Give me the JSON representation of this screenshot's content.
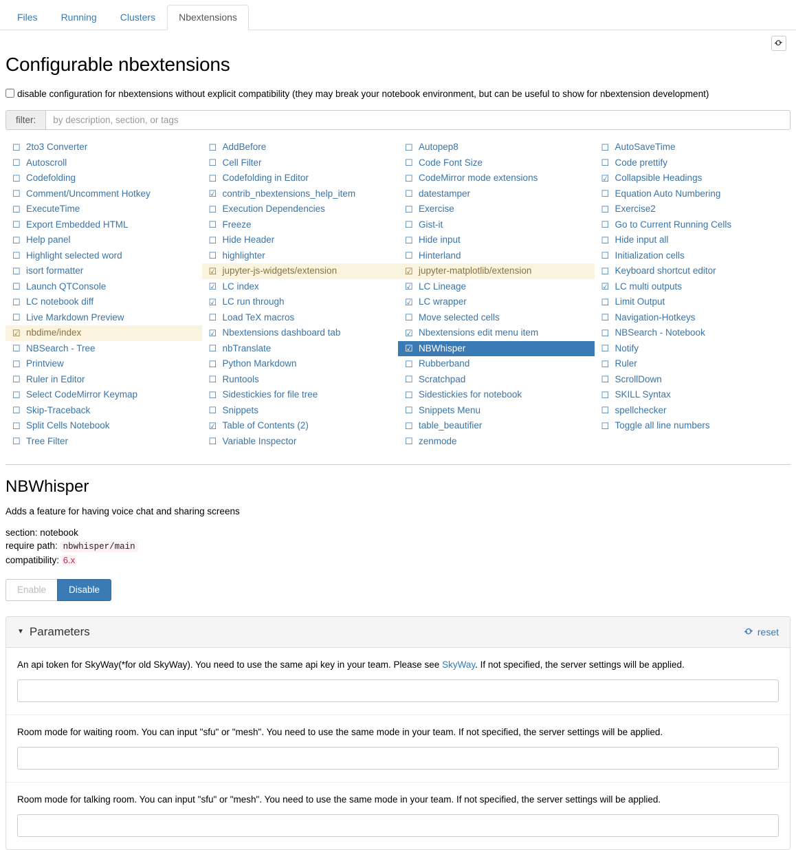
{
  "tabs": [
    {
      "label": "Files",
      "active": false
    },
    {
      "label": "Running",
      "active": false
    },
    {
      "label": "Clusters",
      "active": false
    },
    {
      "label": "Nbextensions",
      "active": true
    }
  ],
  "header": {
    "title": "Configurable nbextensions",
    "refresh_icon": "refresh-icon"
  },
  "disable_config": {
    "checked": false,
    "label": "disable configuration for nbextensions without explicit compatibility (they may break your notebook environment, but can be useful to show for nbextension development)"
  },
  "filter": {
    "label": "filter:",
    "placeholder": "by description, section, or tags",
    "value": ""
  },
  "extensions": [
    {
      "name": "2to3 Converter",
      "checked": false,
      "state": "normal"
    },
    {
      "name": "Autoscroll",
      "checked": false,
      "state": "normal"
    },
    {
      "name": "Codefolding",
      "checked": false,
      "state": "normal"
    },
    {
      "name": "Comment/Uncomment Hotkey",
      "checked": false,
      "state": "normal"
    },
    {
      "name": "ExecuteTime",
      "checked": false,
      "state": "normal"
    },
    {
      "name": "Export Embedded HTML",
      "checked": false,
      "state": "normal"
    },
    {
      "name": "Help panel",
      "checked": false,
      "state": "normal"
    },
    {
      "name": "Highlight selected word",
      "checked": false,
      "state": "normal"
    },
    {
      "name": "isort formatter",
      "checked": false,
      "state": "normal"
    },
    {
      "name": "Launch QTConsole",
      "checked": false,
      "state": "normal"
    },
    {
      "name": "LC notebook diff",
      "checked": false,
      "state": "normal"
    },
    {
      "name": "Live Markdown Preview",
      "checked": false,
      "state": "normal"
    },
    {
      "name": "nbdime/index",
      "checked": true,
      "state": "incompatible"
    },
    {
      "name": "NBSearch - Tree",
      "checked": false,
      "state": "normal"
    },
    {
      "name": "Printview",
      "checked": false,
      "state": "normal"
    },
    {
      "name": "Ruler in Editor",
      "checked": false,
      "state": "normal"
    },
    {
      "name": "Select CodeMirror Keymap",
      "checked": false,
      "state": "normal"
    },
    {
      "name": "Skip-Traceback",
      "checked": false,
      "state": "normal"
    },
    {
      "name": "Split Cells Notebook",
      "checked": false,
      "state": "normal"
    },
    {
      "name": "Tree Filter",
      "checked": false,
      "state": "normal"
    },
    {
      "name": "AddBefore",
      "checked": false,
      "state": "normal"
    },
    {
      "name": "Cell Filter",
      "checked": false,
      "state": "normal"
    },
    {
      "name": "Codefolding in Editor",
      "checked": false,
      "state": "normal"
    },
    {
      "name": "contrib_nbextensions_help_item",
      "checked": true,
      "state": "normal"
    },
    {
      "name": "Execution Dependencies",
      "checked": false,
      "state": "normal"
    },
    {
      "name": "Freeze",
      "checked": false,
      "state": "normal"
    },
    {
      "name": "Hide Header",
      "checked": false,
      "state": "normal"
    },
    {
      "name": "highlighter",
      "checked": false,
      "state": "normal"
    },
    {
      "name": "jupyter-js-widgets/extension",
      "checked": true,
      "state": "incompatible"
    },
    {
      "name": "LC index",
      "checked": true,
      "state": "normal"
    },
    {
      "name": "LC run through",
      "checked": true,
      "state": "normal"
    },
    {
      "name": "Load TeX macros",
      "checked": false,
      "state": "normal"
    },
    {
      "name": "Nbextensions dashboard tab",
      "checked": true,
      "state": "normal"
    },
    {
      "name": "nbTranslate",
      "checked": false,
      "state": "normal"
    },
    {
      "name": "Python Markdown",
      "checked": false,
      "state": "normal"
    },
    {
      "name": "Runtools",
      "checked": false,
      "state": "normal"
    },
    {
      "name": "Sidestickies for file tree",
      "checked": false,
      "state": "normal"
    },
    {
      "name": "Snippets",
      "checked": false,
      "state": "normal"
    },
    {
      "name": "Table of Contents (2)",
      "checked": true,
      "state": "normal"
    },
    {
      "name": "Variable Inspector",
      "checked": false,
      "state": "normal"
    },
    {
      "name": "Autopep8",
      "checked": false,
      "state": "normal"
    },
    {
      "name": "Code Font Size",
      "checked": false,
      "state": "normal"
    },
    {
      "name": "CodeMirror mode extensions",
      "checked": false,
      "state": "normal"
    },
    {
      "name": "datestamper",
      "checked": false,
      "state": "normal"
    },
    {
      "name": "Exercise",
      "checked": false,
      "state": "normal"
    },
    {
      "name": "Gist-it",
      "checked": false,
      "state": "normal"
    },
    {
      "name": "Hide input",
      "checked": false,
      "state": "normal"
    },
    {
      "name": "Hinterland",
      "checked": false,
      "state": "normal"
    },
    {
      "name": "jupyter-matplotlib/extension",
      "checked": true,
      "state": "incompatible"
    },
    {
      "name": "LC Lineage",
      "checked": true,
      "state": "normal"
    },
    {
      "name": "LC wrapper",
      "checked": true,
      "state": "normal"
    },
    {
      "name": "Move selected cells",
      "checked": false,
      "state": "normal"
    },
    {
      "name": "Nbextensions edit menu item",
      "checked": true,
      "state": "normal"
    },
    {
      "name": "NBWhisper",
      "checked": true,
      "state": "selected"
    },
    {
      "name": "Rubberband",
      "checked": false,
      "state": "normal"
    },
    {
      "name": "Scratchpad",
      "checked": false,
      "state": "normal"
    },
    {
      "name": "Sidestickies for notebook",
      "checked": false,
      "state": "normal"
    },
    {
      "name": "Snippets Menu",
      "checked": false,
      "state": "normal"
    },
    {
      "name": "table_beautifier",
      "checked": false,
      "state": "normal"
    },
    {
      "name": "zenmode",
      "checked": false,
      "state": "normal"
    },
    {
      "name": "AutoSaveTime",
      "checked": false,
      "state": "normal"
    },
    {
      "name": "Code prettify",
      "checked": false,
      "state": "normal"
    },
    {
      "name": "Collapsible Headings",
      "checked": true,
      "state": "normal"
    },
    {
      "name": "Equation Auto Numbering",
      "checked": false,
      "state": "normal"
    },
    {
      "name": "Exercise2",
      "checked": false,
      "state": "normal"
    },
    {
      "name": "Go to Current Running Cells",
      "checked": false,
      "state": "normal"
    },
    {
      "name": "Hide input all",
      "checked": false,
      "state": "normal"
    },
    {
      "name": "Initialization cells",
      "checked": false,
      "state": "normal"
    },
    {
      "name": "Keyboard shortcut editor",
      "checked": false,
      "state": "normal"
    },
    {
      "name": "LC multi outputs",
      "checked": true,
      "state": "normal"
    },
    {
      "name": "Limit Output",
      "checked": false,
      "state": "normal"
    },
    {
      "name": "Navigation-Hotkeys",
      "checked": false,
      "state": "normal"
    },
    {
      "name": "NBSearch - Notebook",
      "checked": false,
      "state": "normal"
    },
    {
      "name": "Notify",
      "checked": false,
      "state": "normal"
    },
    {
      "name": "Ruler",
      "checked": false,
      "state": "normal"
    },
    {
      "name": "ScrollDown",
      "checked": false,
      "state": "normal"
    },
    {
      "name": "SKILL Syntax",
      "checked": false,
      "state": "normal"
    },
    {
      "name": "spellchecker",
      "checked": false,
      "state": "normal"
    },
    {
      "name": "Toggle all line numbers",
      "checked": false,
      "state": "normal"
    },
    {
      "name": "",
      "checked": false,
      "state": "empty"
    }
  ],
  "detail": {
    "title": "NBWhisper",
    "description": "Adds a feature for having voice chat and sharing screens",
    "section_label": "section:",
    "section_value": "notebook",
    "require_label": "require path:",
    "require_value": "nbwhisper/main",
    "compat_label": "compatibility:",
    "compat_value": "6.x",
    "enable_label": "Enable",
    "disable_label": "Disable",
    "enable_disabled": true
  },
  "parameters": {
    "panel_title": "Parameters",
    "caret_icon": "caret-down-icon",
    "reset_label": "reset",
    "reset_icon": "reset-icon",
    "items": [
      {
        "label_before": "An api token for SkyWay(*for old SkyWay). You need to use the same api key in your team. Please see ",
        "link": "SkyWay",
        "label_after": ". If not specified, the server settings will be applied.",
        "value": ""
      },
      {
        "label_before": "Room mode for waiting room. You can input \"sfu\" or \"mesh\". You need to use the same mode in your team. If not specified, the server settings will be applied.",
        "link": "",
        "label_after": "",
        "value": ""
      },
      {
        "label_before": "Room mode for talking room. You can input \"sfu\" or \"mesh\". You need to use the same mode in your team. If not specified, the server settings will be applied.",
        "link": "",
        "label_after": "",
        "value": ""
      }
    ]
  },
  "colors": {
    "link": "#337ab7",
    "selected_bg": "#3a7ab5",
    "incompatible_bg": "#faf3de",
    "ext_text": "#3a74a8",
    "compat_red": "#c7254e"
  },
  "glyphs": {
    "checked": "☑",
    "unchecked": "☐"
  }
}
